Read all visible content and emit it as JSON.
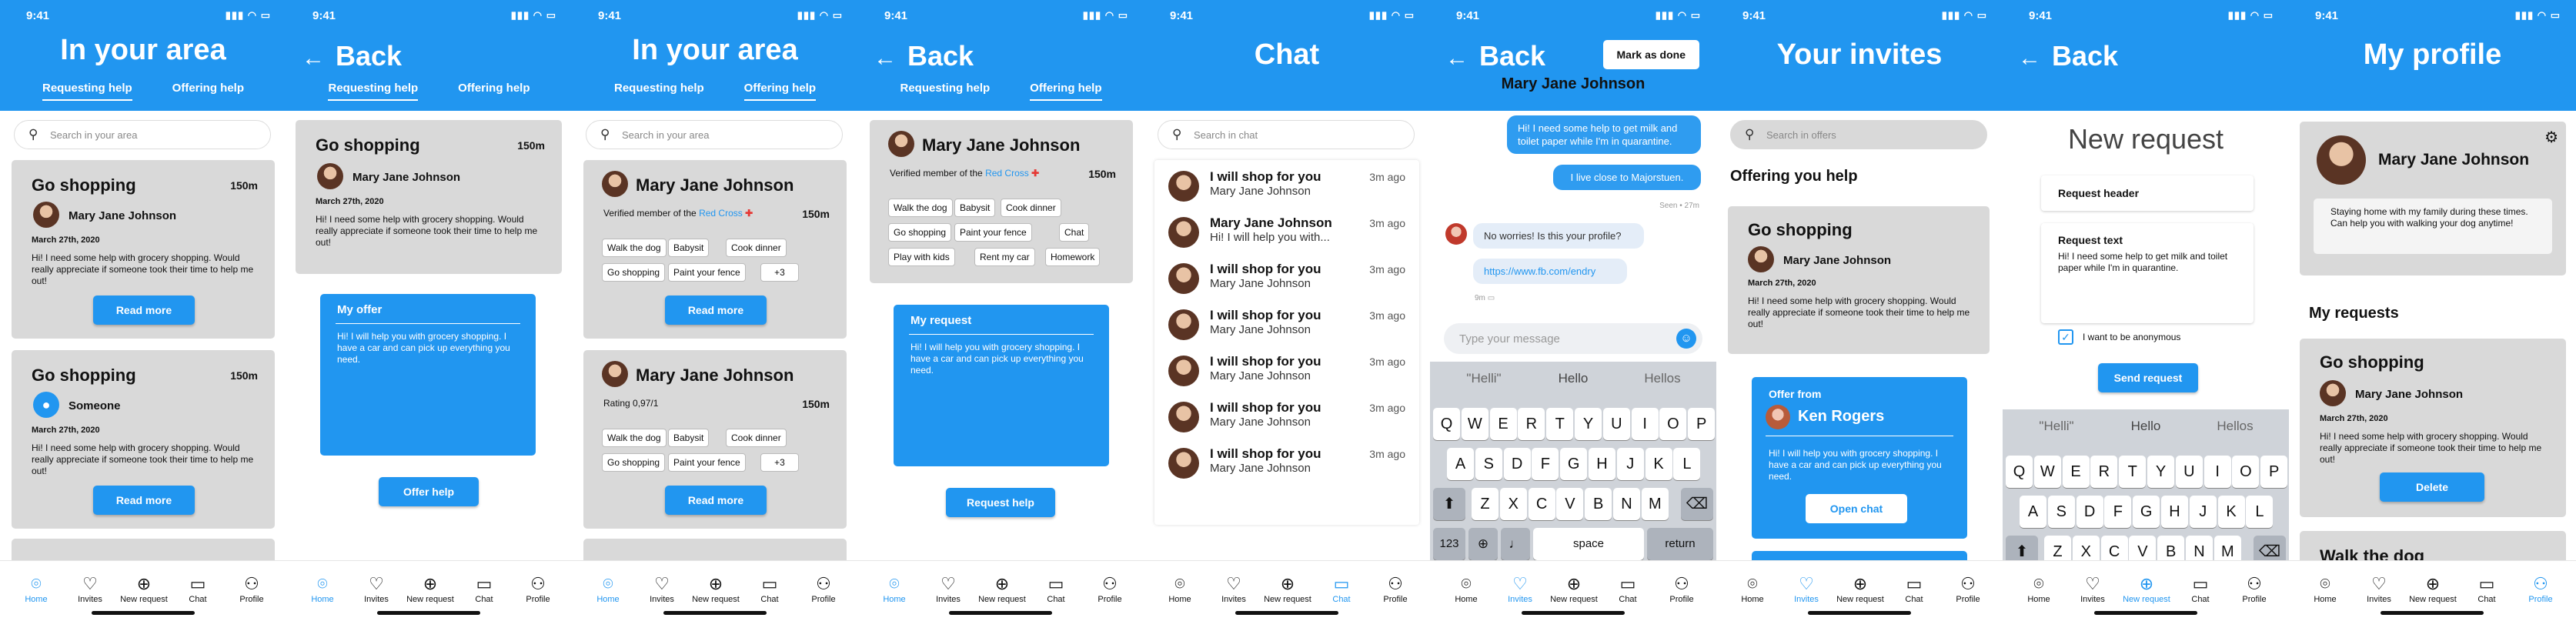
{
  "status_time": "9:41",
  "status_icons": "▮▮▮ ◠ ▭",
  "nav": {
    "home": "Home",
    "invites": "Invites",
    "new_request": "New request",
    "chat": "Chat",
    "profile": "Profile"
  },
  "common": {
    "in_your_area": "In your area",
    "back": "Back",
    "requesting_help": "Requesting help",
    "offering_help": "Offering help",
    "search_area": "Search in your area",
    "read_more": "Read more",
    "go_shopping": "Go shopping",
    "dist150": "150m",
    "mjj": "Mary Jane Johnson",
    "date": "March 27th, 2020",
    "shopping_body": "Hi! I need some help with grocery shopping. Would really appreciate if someone took their time to help me out!",
    "someone": "Someone",
    "plus3": "+3",
    "red_cross_pre": "Verified member of the ",
    "red_cross": "Red Cross",
    "rating": "Rating 0,97/1"
  },
  "chips_a": [
    "Walk the dog",
    "Babysit",
    "Cook dinner",
    "Go shopping",
    "Paint your fence",
    "Chat",
    "Play with kids",
    "Rent my car",
    "Homework"
  ],
  "s2": {
    "my_offer": "My offer",
    "offer_text": "Hi! I will help you with grocery shopping. I have a car and can pick up everything you need.",
    "offer_help": "Offer help"
  },
  "s4": {
    "my_request": "My request",
    "request_text": "Hi! I will help you with grocery shopping. I have a car and can pick up everything you need.",
    "request_help": "Request help"
  },
  "s5": {
    "title": "Chat",
    "search": "Search in chat",
    "rows": [
      {
        "name": "I will shop for you",
        "msg": "Mary Jane Johnson",
        "time": "3m ago"
      },
      {
        "name": "Mary Jane Johnson",
        "msg": "Hi! I will help you with...",
        "time": "3m ago"
      },
      {
        "name": "I will shop for you",
        "msg": "Mary Jane Johnson",
        "time": "3m ago"
      },
      {
        "name": "I will shop for you",
        "msg": "Mary Jane Johnson",
        "time": "3m ago"
      },
      {
        "name": "I will shop for you",
        "msg": "Mary Jane Johnson",
        "time": "3m ago"
      },
      {
        "name": "I will shop for you",
        "msg": "Mary Jane Johnson",
        "time": "3m ago"
      },
      {
        "name": "I will shop for you",
        "msg": "Mary Jane Johnson",
        "time": "3m ago"
      }
    ]
  },
  "s6": {
    "mark_done": "Mark as done",
    "chat_name": "Mary Jane Johnson",
    "m1": "Hi! I need some help to get milk and toilet paper while I'm in quarantine.",
    "m2": "I live close to Majorstuen.",
    "seen": "Seen • 27m",
    "m3": "No worries! Is this your profile?",
    "m4": "https://www.fb.com/endry",
    "m4t": "9m",
    "placeholder": "Type your message",
    "suggestions": [
      "\"Helli\"",
      "Hello",
      "Hellos"
    ],
    "row1": [
      "Q",
      "W",
      "E",
      "R",
      "T",
      "Y",
      "U",
      "I",
      "O",
      "P"
    ],
    "row2": [
      "A",
      "S",
      "D",
      "F",
      "G",
      "H",
      "J",
      "K",
      "L"
    ],
    "row3": [
      "Z",
      "X",
      "C",
      "V",
      "B",
      "N",
      "M"
    ],
    "k123": "123",
    "space": "space",
    "return": "return"
  },
  "s7": {
    "title": "Your invites",
    "search": "Search in offers",
    "offering": "Offering you help",
    "offer_from": "Offer from",
    "ken": "Ken Rogers",
    "offer_text": "Hi! I will help you with grocery shopping. I have a car and can pick up everything you need.",
    "open_chat": "Open chat"
  },
  "s8": {
    "title": "New request",
    "header": "Request header",
    "text_label": "Request text",
    "text": "Hi! I need some help to get milk and toilet paper while I'm in quarantine.",
    "anon": "I want to be anonymous",
    "send": "Send request"
  },
  "s9": {
    "title": "My profile",
    "bio": "Staying home with my family during these times. Can help you with walking your dog anytime!",
    "my_requests": "My requests",
    "delete": "Delete",
    "walk": "Walk the dog"
  }
}
